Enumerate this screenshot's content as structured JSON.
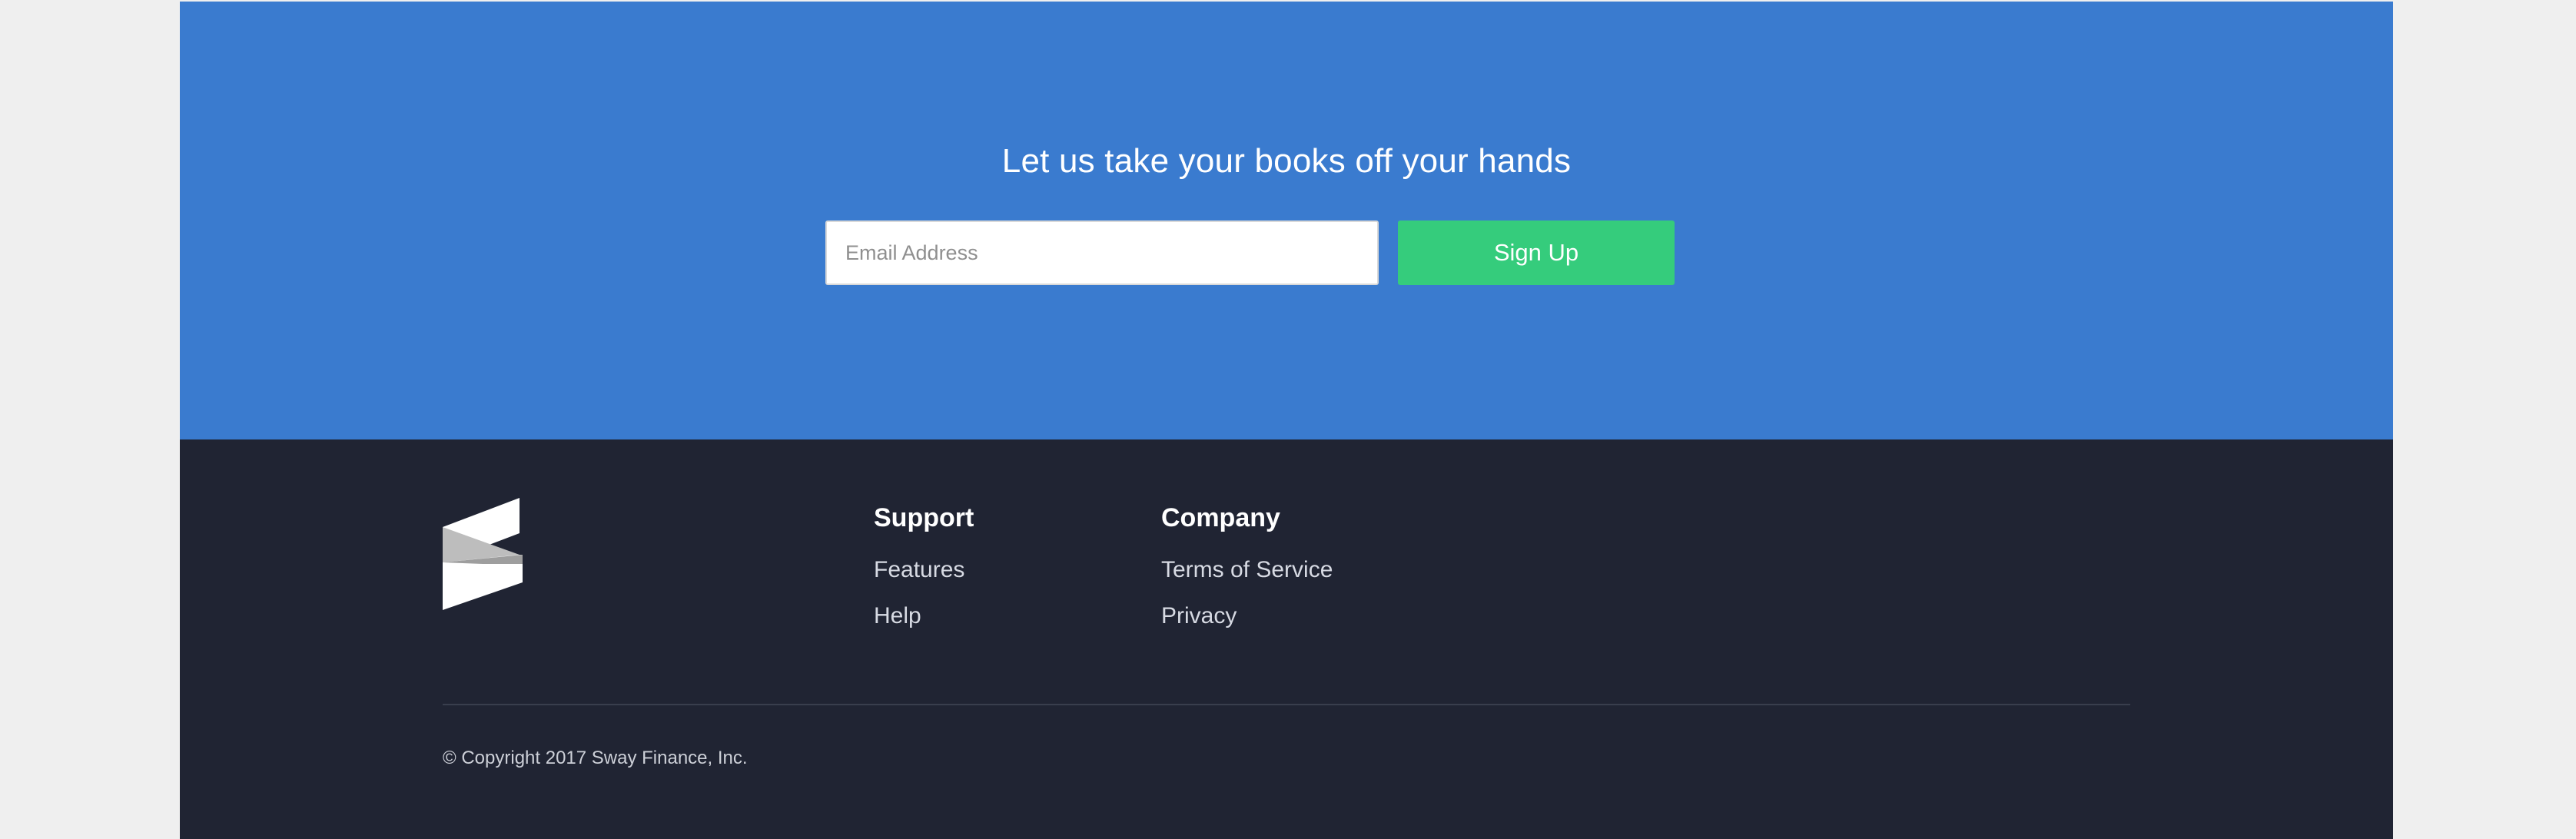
{
  "cta": {
    "heading": "Let us take your books off your hands",
    "email_placeholder": "Email Address",
    "signup_label": "Sign Up"
  },
  "footer": {
    "logo_icon": "sway-logo-icon",
    "columns": [
      {
        "title": "Support",
        "links": [
          "Features",
          "Help"
        ]
      },
      {
        "title": "Company",
        "links": [
          "Terms of Service",
          "Privacy"
        ]
      }
    ],
    "copyright": "© Copyright 2017 Sway Finance, Inc."
  },
  "colors": {
    "cta_background": "#3a7bcf",
    "signup_button": "#35cc7c",
    "footer_background": "#202433",
    "page_background": "#efefef"
  }
}
